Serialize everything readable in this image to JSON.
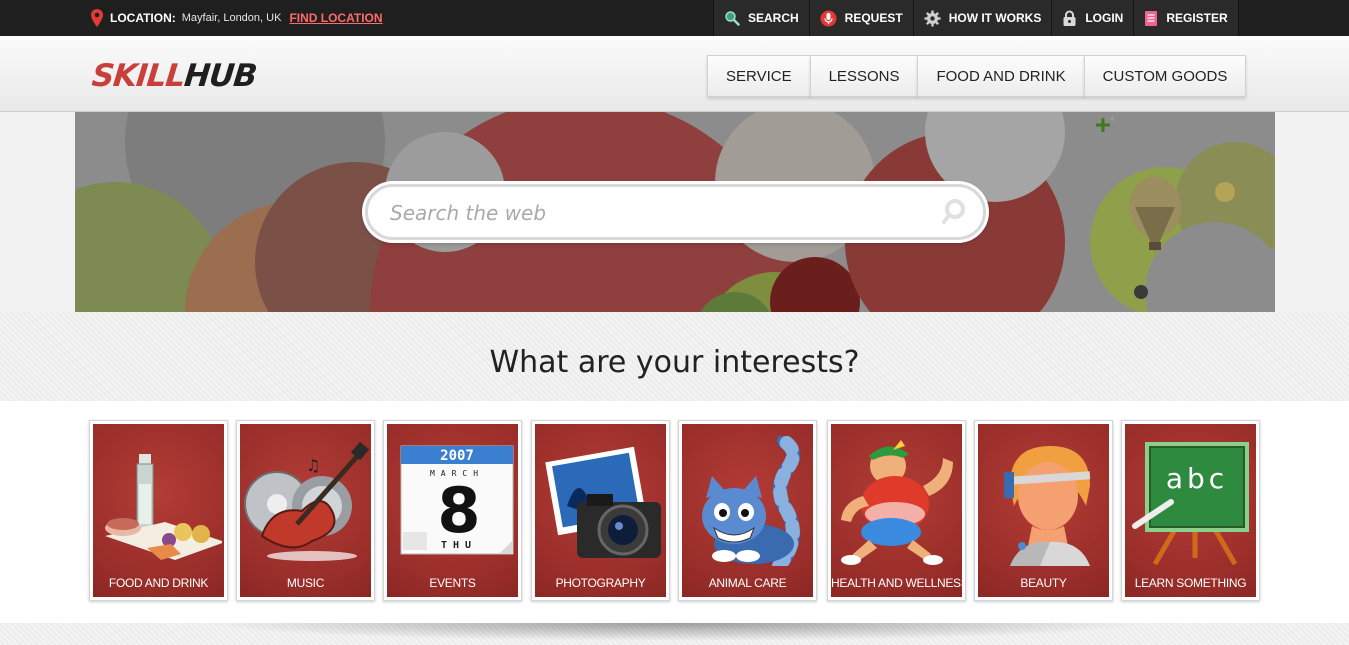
{
  "topbar": {
    "location_label": "LOCATION:",
    "location_value": "Mayfair, London, UK",
    "find_location": "FIND LOCATION",
    "items": [
      {
        "label": "SEARCH",
        "icon": "magnifier-icon"
      },
      {
        "label": "REQUEST",
        "icon": "microphone-icon"
      },
      {
        "label": "HOW IT WORKS",
        "icon": "gear-icon"
      },
      {
        "label": "LOGIN",
        "icon": "lock-icon"
      },
      {
        "label": "REGISTER",
        "icon": "document-icon"
      }
    ]
  },
  "header": {
    "logo_part1": "SKILL",
    "logo_part2": "HUB",
    "nav": [
      "SERVICE",
      "LESSONS",
      "FOOD AND DRINK",
      "CUSTOM GOODS"
    ]
  },
  "hero": {
    "search_placeholder": "Search the web"
  },
  "interests": {
    "heading": "What are your interests?",
    "tiles": [
      {
        "label": "FOOD AND DRINK",
        "icon": "food-and-drink-icon"
      },
      {
        "label": "MUSIC",
        "icon": "guitar-icon"
      },
      {
        "label": "EVENTS",
        "icon": "calendar-icon",
        "calendar": {
          "year": "2007",
          "month": "MARCH",
          "day": "8",
          "weekday": "THU"
        }
      },
      {
        "label": "PHOTOGRAPHY",
        "icon": "camera-icon"
      },
      {
        "label": "ANIMAL CARE",
        "icon": "cat-icon"
      },
      {
        "label": "HEALTH AND WELLNESS",
        "icon": "runner-icon"
      },
      {
        "label": "BEAUTY",
        "icon": "beauty-face-icon"
      },
      {
        "label": "LEARN SOMETHING",
        "icon": "chalkboard-icon",
        "board_text": "abc"
      }
    ]
  },
  "colors": {
    "accent": "#c8403c",
    "link": "#ff6a6a",
    "tile_bg": "#a0312d",
    "topbar_bg": "#1f1f1f"
  }
}
